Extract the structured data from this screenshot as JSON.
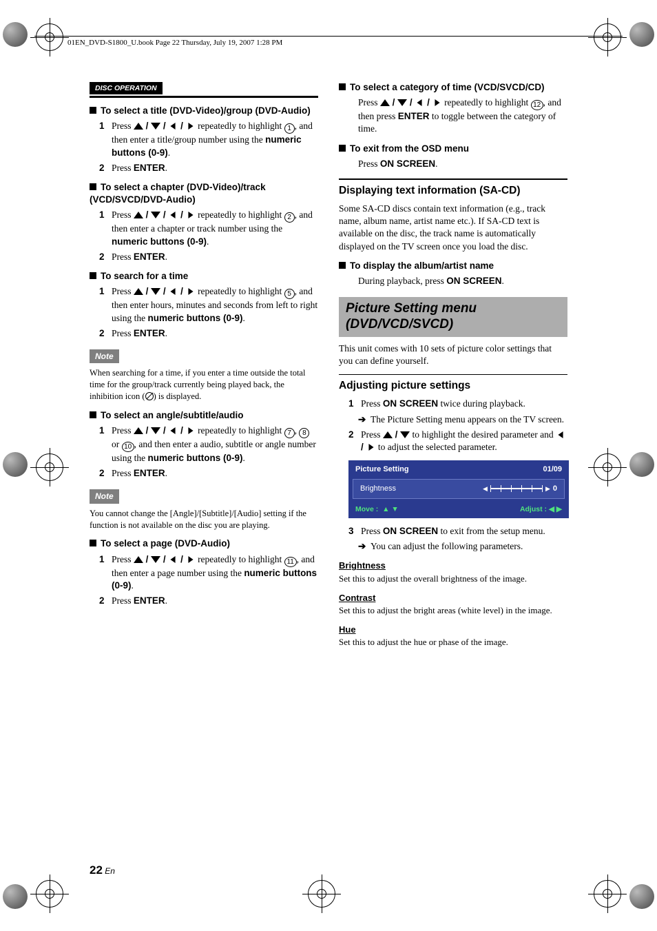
{
  "header_line": "01EN_DVD-S1800_U.book  Page 22  Thursday, July 19, 2007  1:28 PM",
  "disc_op": "DISC OPERATION",
  "left": {
    "h1": "To select a title (DVD-Video)/group (DVD-Audio)",
    "s1a_pre": "Press ",
    "s1a_post": " repeatedly to highlight ",
    "s1a_end": ", and then enter a title/group number using the ",
    "numeric": "numeric buttons (0-9)",
    "s2": "Press ",
    "enter": "ENTER",
    "h2": "To select a chapter (DVD-Video)/track (VCD/SVCD/DVD-Audio)",
    "s1b_post": " repeatedly to highlight ",
    "s1b_end": ", and then enter a chapter or track number using the ",
    "h3": "To search for a time",
    "s1c_end": ", and then enter hours, minutes and seconds from left to right using the ",
    "note_label": "Note",
    "note1": "When searching for a time, if you enter a time outside the total time for the group/track currently being played back, the inhibition icon (",
    "note1_end": ") is displayed.",
    "h4": "To select an angle/subtitle/audio",
    "s1d_mid": ", ",
    "s1d_or": " or ",
    "s1d_end": ", and then enter a audio, subtitle or angle number using the ",
    "note2": "You cannot change the [Angle]/[Subtitle]/[Audio] setting if the function is not available on the disc you are playing.",
    "h5": "To select a page (DVD-Audio)",
    "s1e_end": ", and then enter a page number using the ",
    "period": "."
  },
  "right": {
    "h1": "To select a category of time (VCD/SVCD/CD)",
    "r1_end": ", and then press ",
    "r1_tail": " to toggle between the category of time.",
    "h2": "To exit from the OSD menu",
    "r2": "Press ",
    "onscreen": "ON SCREEN",
    "sub1": "Displaying text information (SA-CD)",
    "p1": "Some SA-CD discs contain text information (e.g., track name, album name, artist name etc.). If SA-CD text is available on the disc, the track name is automatically displayed on the TV screen once you load the disc.",
    "h3": "To display the album/artist name",
    "r3": "During playback, press ",
    "main": "Picture Setting menu (DVD/VCD/SVCD)",
    "p2": "This unit comes with 10 sets of picture color settings that you can define yourself.",
    "sub2": "Adjusting picture settings",
    "s1": "Press ",
    "s1_tail": " twice during playback.",
    "s1_sub": "The Picture Setting menu appears on the TV screen.",
    "s2": "Press ",
    "s2_mid": " to highlight the desired parameter and ",
    "s2_tail": " to adjust the selected parameter.",
    "s3": "Press ",
    "s3_tail": " to exit from the setup menu.",
    "s3_sub": "You can adjust the following parameters.",
    "osd": {
      "title": "Picture Setting",
      "count": "01/09",
      "param": "Brightness",
      "value": "0",
      "move": "Move :",
      "adjust": "Adjust :"
    },
    "params": [
      {
        "name": "Brightness",
        "desc": "Set this to adjust the overall brightness of the image."
      },
      {
        "name": "Contrast",
        "desc": "Set this to adjust the bright areas (white level) in the image."
      },
      {
        "name": "Hue",
        "desc": "Set this to adjust the hue or phase of the image."
      }
    ]
  },
  "page": {
    "num": "22",
    "suffix": " En"
  }
}
